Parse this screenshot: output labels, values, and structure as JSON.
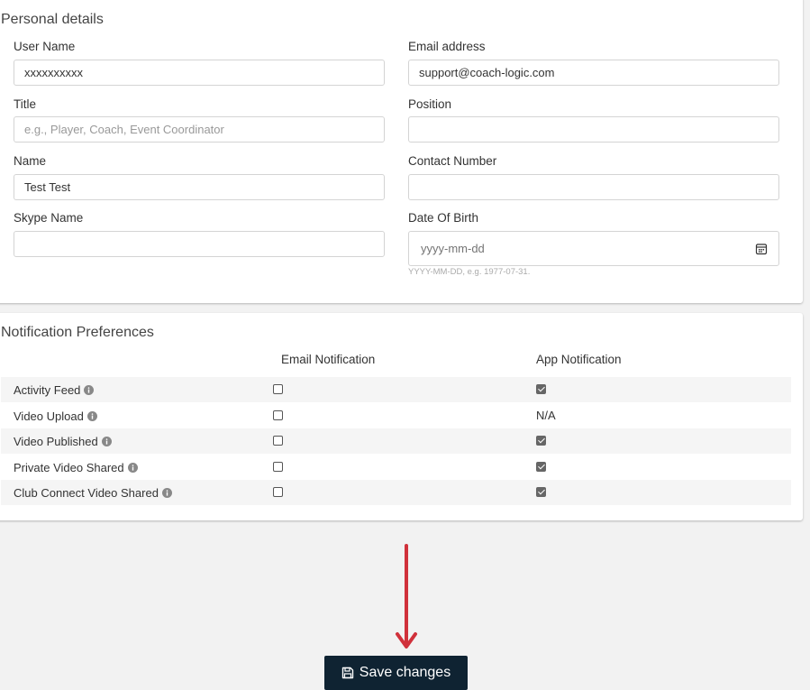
{
  "personal": {
    "title": "Personal details",
    "user_name_label": "User Name",
    "user_name_value": "xxxxxxxxxx",
    "email_label": "Email address",
    "email_value": "support@coach-logic.com",
    "title_label": "Title",
    "title_placeholder": "e.g., Player, Coach, Event Coordinator",
    "position_label": "Position",
    "position_value": "",
    "name_label": "Name",
    "name_value": "Test Test",
    "contact_label": "Contact Number",
    "contact_value": "",
    "skype_label": "Skype Name",
    "skype_value": "",
    "dob_label": "Date Of Birth",
    "dob_placeholder": "yyyy-mm-dd",
    "dob_hint": "YYYY-MM-DD, e.g. 1977-07-31."
  },
  "notifications": {
    "title": "Notification Preferences",
    "email_col": "Email Notification",
    "app_col": "App Notification",
    "rows": [
      {
        "label": "Activity Feed",
        "email": false,
        "app": true
      },
      {
        "label": "Video Upload",
        "email": false,
        "app": "N/A"
      },
      {
        "label": "Video Published",
        "email": false,
        "app": true
      },
      {
        "label": "Private Video Shared",
        "email": false,
        "app": true
      },
      {
        "label": "Club Connect Video Shared",
        "email": false,
        "app": true
      }
    ]
  },
  "footer": {
    "save_label": "Save changes"
  },
  "icons": {
    "info": "info-icon",
    "calendar": "calendar-icon",
    "save": "floppy-disk-icon",
    "arrow": "down-arrow-icon"
  },
  "colors": {
    "save_button_bg": "#0f2332",
    "arrow": "#d0313b"
  }
}
